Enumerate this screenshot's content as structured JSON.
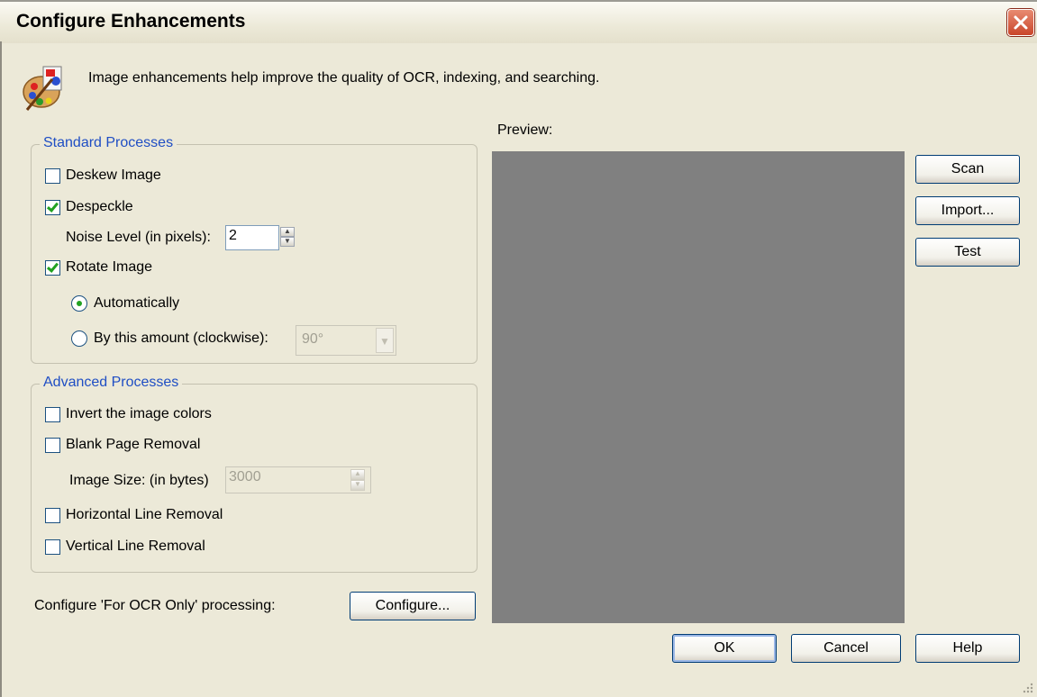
{
  "window": {
    "title": "Configure Enhancements",
    "close_glyph": "✕"
  },
  "intro": {
    "icon": "palette-icon",
    "text": "Image enhancements help improve the quality of OCR, indexing, and searching."
  },
  "standard": {
    "legend": "Standard Processes",
    "deskew": {
      "label": "Deskew Image",
      "checked": false
    },
    "despeckle": {
      "label": "Despeckle",
      "checked": true
    },
    "noise": {
      "label": "Noise Level (in pixels):",
      "value": "2"
    },
    "rotate": {
      "label": "Rotate Image",
      "checked": true
    },
    "auto": {
      "label": "Automatically",
      "selected": true
    },
    "amount": {
      "label": "By this amount (clockwise):",
      "selected": false,
      "value": "90°"
    }
  },
  "advanced": {
    "legend": "Advanced Processes",
    "invert": {
      "label": "Invert the image colors",
      "checked": false
    },
    "blank": {
      "label": "Blank Page Removal",
      "checked": false
    },
    "size": {
      "label": "Image Size: (in bytes)",
      "value": "3000"
    },
    "hline": {
      "label": "Horizontal Line Removal",
      "checked": false
    },
    "vline": {
      "label": "Vertical Line Removal",
      "checked": false
    }
  },
  "ocr": {
    "label": "Configure 'For OCR Only' processing:",
    "button": "Configure..."
  },
  "preview": {
    "label": "Preview:"
  },
  "side_buttons": {
    "scan": "Scan",
    "import": "Import...",
    "test": "Test"
  },
  "footer": {
    "ok": "OK",
    "cancel": "Cancel",
    "help": "Help"
  },
  "colors": {
    "legend": "#1F4EC4",
    "preview_bg": "#808080",
    "dialog_bg": "#ECE9D8"
  }
}
